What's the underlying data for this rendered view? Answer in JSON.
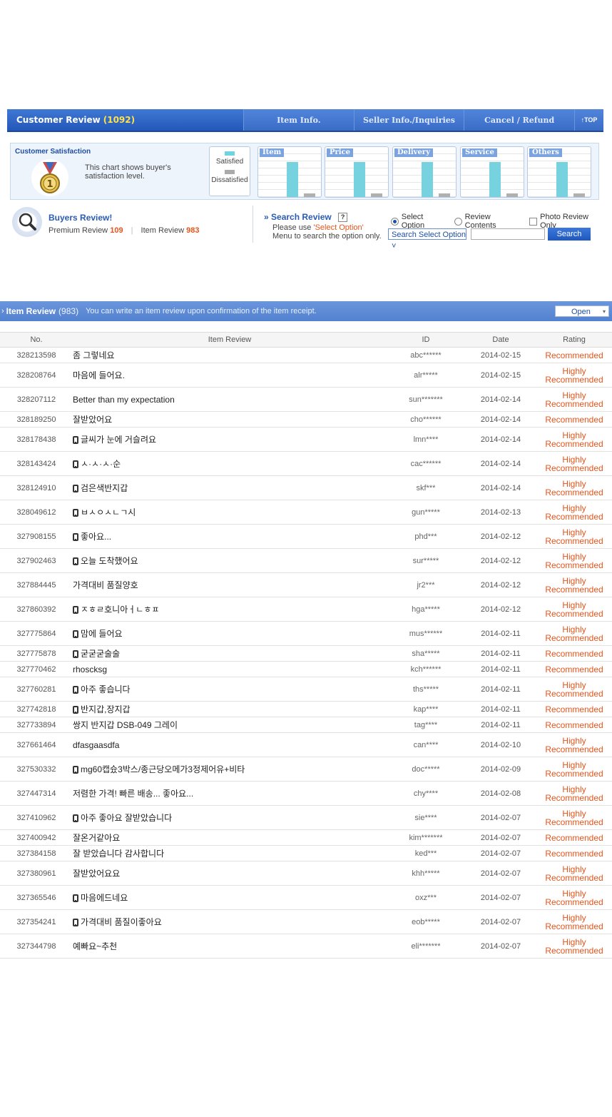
{
  "header": {
    "customer_review_label": "Customer Review",
    "customer_review_count": "(1092)",
    "tabs": [
      "Item Info.",
      "Seller Info./Inquiries",
      "Cancel / Refund"
    ],
    "top_label": "↑TOP"
  },
  "satisfaction": {
    "title": "Customer Satisfaction",
    "description": "This chart shows buyer's satisfaction level.",
    "legend_satisfied": "Satisfied",
    "legend_dissatisfied": "Dissatisfied",
    "medal_number": "1",
    "colors": {
      "satisfied": "#76d2de",
      "dissatisfied": "#b0b0b0"
    }
  },
  "chart_data": {
    "type": "bar",
    "categories": [
      "Item",
      "Price",
      "Delivery",
      "Service",
      "Others"
    ],
    "series": [
      {
        "name": "Satisfied",
        "values": [
          95,
          95,
          95,
          95,
          95
        ]
      },
      {
        "name": "Dissatisfied",
        "values": [
          5,
          5,
          5,
          5,
          5
        ]
      }
    ],
    "ylim": [
      0,
      100
    ]
  },
  "buyers": {
    "title": "Buyers Review!",
    "premium_label": "Premium Review",
    "premium_count": "109",
    "item_label": "Item Review",
    "item_count": "983"
  },
  "search": {
    "title": "Search Review",
    "help": "?",
    "note_prefix": "Please use ",
    "note_highlight": "'Select Option'",
    "note_suffix": "Menu to search the option only.",
    "options": [
      "Select Option",
      "Review Contents"
    ],
    "photo_only": "Photo Review Only",
    "select_value": "Search Select Option ˅",
    "button": "Search"
  },
  "item_review": {
    "title": "Item Review",
    "count": "(983)",
    "description": "You can write an item review upon confirmation of the item receipt.",
    "open_label": "Open"
  },
  "table": {
    "headers": [
      "No.",
      "Item Review",
      "ID",
      "Date",
      "Rating"
    ],
    "rows": [
      {
        "no": "328213598",
        "text": "좀 그렇네요",
        "mobile": false,
        "id": "abc******",
        "date": "2014-02-15",
        "rating": [
          "Recommended"
        ]
      },
      {
        "no": "328208764",
        "text": "마음에 들어요.",
        "mobile": false,
        "id": "alr*****",
        "date": "2014-02-15",
        "rating": [
          "Highly",
          "Recommended"
        ]
      },
      {
        "no": "328207112",
        "text": "Better than my expectation",
        "mobile": false,
        "id": "sun*******",
        "date": "2014-02-14",
        "rating": [
          "Highly",
          "Recommended"
        ]
      },
      {
        "no": "328189250",
        "text": "잘받았어요",
        "mobile": false,
        "id": "cho******",
        "date": "2014-02-14",
        "rating": [
          "Recommended"
        ]
      },
      {
        "no": "328178438",
        "text": "글씨가 눈에 거슬려요",
        "mobile": true,
        "id": "lmn****",
        "date": "2014-02-14",
        "rating": [
          "Highly",
          "Recommended"
        ]
      },
      {
        "no": "328143424",
        "text": "ㅅ·ㅅ·ㅅ·순",
        "mobile": true,
        "id": "cac******",
        "date": "2014-02-14",
        "rating": [
          "Highly",
          "Recommended"
        ]
      },
      {
        "no": "328124910",
        "text": "검은색반지갑",
        "mobile": true,
        "id": "skf***",
        "date": "2014-02-14",
        "rating": [
          "Highly",
          "Recommended"
        ]
      },
      {
        "no": "328049612",
        "text": "ㅂㅅㅇㅅㄴㄱ시",
        "mobile": true,
        "id": "gun*****",
        "date": "2014-02-13",
        "rating": [
          "Highly",
          "Recommended"
        ]
      },
      {
        "no": "327908155",
        "text": "좋아요...",
        "mobile": true,
        "id": "phd***",
        "date": "2014-02-12",
        "rating": [
          "Highly",
          "Recommended"
        ]
      },
      {
        "no": "327902463",
        "text": "오늘 도착했어요",
        "mobile": true,
        "id": "sur*****",
        "date": "2014-02-12",
        "rating": [
          "Highly",
          "Recommended"
        ]
      },
      {
        "no": "327884445",
        "text": "가격대비 품질양호",
        "mobile": false,
        "id": "jr2***",
        "date": "2014-02-12",
        "rating": [
          "Highly",
          "Recommended"
        ]
      },
      {
        "no": "327860392",
        "text": "ㅈㅎㄹ호니아ㅓㄴㅎㅍ",
        "mobile": true,
        "id": "hga*****",
        "date": "2014-02-12",
        "rating": [
          "Highly",
          "Recommended"
        ]
      },
      {
        "no": "327775864",
        "text": "맘에 들어요",
        "mobile": true,
        "id": "mus******",
        "date": "2014-02-11",
        "rating": [
          "Highly",
          "Recommended"
        ]
      },
      {
        "no": "327775878",
        "text": "굳굳굳술술",
        "mobile": true,
        "id": "sha*****",
        "date": "2014-02-11",
        "rating": [
          "Recommended"
        ]
      },
      {
        "no": "327770462",
        "text": "rhoscksg",
        "mobile": false,
        "id": "kch******",
        "date": "2014-02-11",
        "rating": [
          "Recommended"
        ]
      },
      {
        "no": "327760281",
        "text": "아주 좋습니다",
        "mobile": true,
        "id": "ths*****",
        "date": "2014-02-11",
        "rating": [
          "Highly",
          "Recommended"
        ]
      },
      {
        "no": "327742818",
        "text": "반지갑,장지갑",
        "mobile": true,
        "id": "kap****",
        "date": "2014-02-11",
        "rating": [
          "Recommended"
        ]
      },
      {
        "no": "327733894",
        "text": "쌍지 반지갑 DSB-049 그레이",
        "mobile": false,
        "id": "tag****",
        "date": "2014-02-11",
        "rating": [
          "Recommended"
        ]
      },
      {
        "no": "327661464",
        "text": "dfasgaasdfa",
        "mobile": false,
        "id": "can****",
        "date": "2014-02-10",
        "rating": [
          "Highly",
          "Recommended"
        ]
      },
      {
        "no": "327530332",
        "text": "mg60캡슜3박스/종근당오메가3정제어유+비타",
        "mobile": true,
        "id": "doc*****",
        "date": "2014-02-09",
        "rating": [
          "Highly",
          "Recommended"
        ]
      },
      {
        "no": "327447314",
        "text": "저렴한 가격! 빠른 배송... 좋아요...",
        "mobile": false,
        "id": "chy****",
        "date": "2014-02-08",
        "rating": [
          "Highly",
          "Recommended"
        ]
      },
      {
        "no": "327410962",
        "text": "아주 좋아요 잘받았습니다",
        "mobile": true,
        "id": "sie****",
        "date": "2014-02-07",
        "rating": [
          "Highly",
          "Recommended"
        ]
      },
      {
        "no": "327400942",
        "text": "잘온거같아요",
        "mobile": false,
        "id": "kim*******",
        "date": "2014-02-07",
        "rating": [
          "Recommended"
        ]
      },
      {
        "no": "327384158",
        "text": "잘 받았습니다 감사합니다",
        "mobile": false,
        "id": "ked***",
        "date": "2014-02-07",
        "rating": [
          "Recommended"
        ]
      },
      {
        "no": "327380961",
        "text": "잘받았어요요",
        "mobile": false,
        "id": "khh*****",
        "date": "2014-02-07",
        "rating": [
          "Highly",
          "Recommended"
        ]
      },
      {
        "no": "327365546",
        "text": "마음에드네요",
        "mobile": true,
        "id": "oxz***",
        "date": "2014-02-07",
        "rating": [
          "Highly",
          "Recommended"
        ]
      },
      {
        "no": "327354241",
        "text": "가격대비 품질이좋아요",
        "mobile": true,
        "id": "eob*****",
        "date": "2014-02-07",
        "rating": [
          "Highly",
          "Recommended"
        ]
      },
      {
        "no": "327344798",
        "text": "예빠요~추천",
        "mobile": false,
        "id": "eli*******",
        "date": "2014-02-07",
        "rating": [
          "Highly",
          "Recommended"
        ]
      }
    ]
  }
}
